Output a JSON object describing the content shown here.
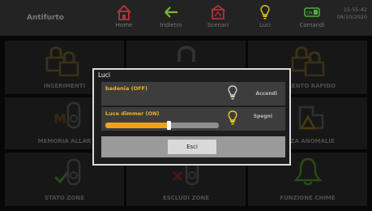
{
  "header": {
    "app_title": "Antifurto",
    "nav": [
      {
        "label": "Home",
        "icon": "home-icon"
      },
      {
        "label": "Indietro",
        "icon": "back-arrow-icon"
      },
      {
        "label": "Scenari",
        "icon": "scenes-icon"
      },
      {
        "label": "Luci",
        "icon": "bulb-icon"
      },
      {
        "label": "Comandi",
        "icon": "on-switch-icon"
      }
    ],
    "on_badge": "ON",
    "time": "15:55:42",
    "date": "08/10/2020"
  },
  "tiles": [
    {
      "label": "INSERIMENTI",
      "icon": "padlocks-icon"
    },
    {
      "label": "",
      "icon": "padlock-icon"
    },
    {
      "label": "RIMENTO RAPIDO",
      "icon": "padlocks-icon"
    },
    {
      "label": "MEMORIA ALLAR",
      "icon": "memory-sensor-icon"
    },
    {
      "label": "",
      "icon": ""
    },
    {
      "label": "LIZZA ANOMALIE",
      "icon": "warning-icon"
    },
    {
      "label": "STATO ZONE",
      "icon": "zone-check-icon"
    },
    {
      "label": "ESCLUDI ZONE",
      "icon": "zone-exclude-icon"
    },
    {
      "label": "FUNZIONE CHIME",
      "icon": "bell-icon"
    }
  ],
  "dialog": {
    "title": "Luci",
    "lights": [
      {
        "name": "badenia (OFF)",
        "action": "Accendi",
        "state": "off"
      },
      {
        "name": "Luce dimmer (ON)",
        "action": "Spegni",
        "state": "on",
        "dimmer_level": 0.56
      }
    ],
    "close_label": "Esci"
  },
  "colors": {
    "accent_yellow": "#f0b31e",
    "home_red": "#b0303a",
    "back_green": "#7ab833",
    "switch_green": "#4caf3a"
  }
}
